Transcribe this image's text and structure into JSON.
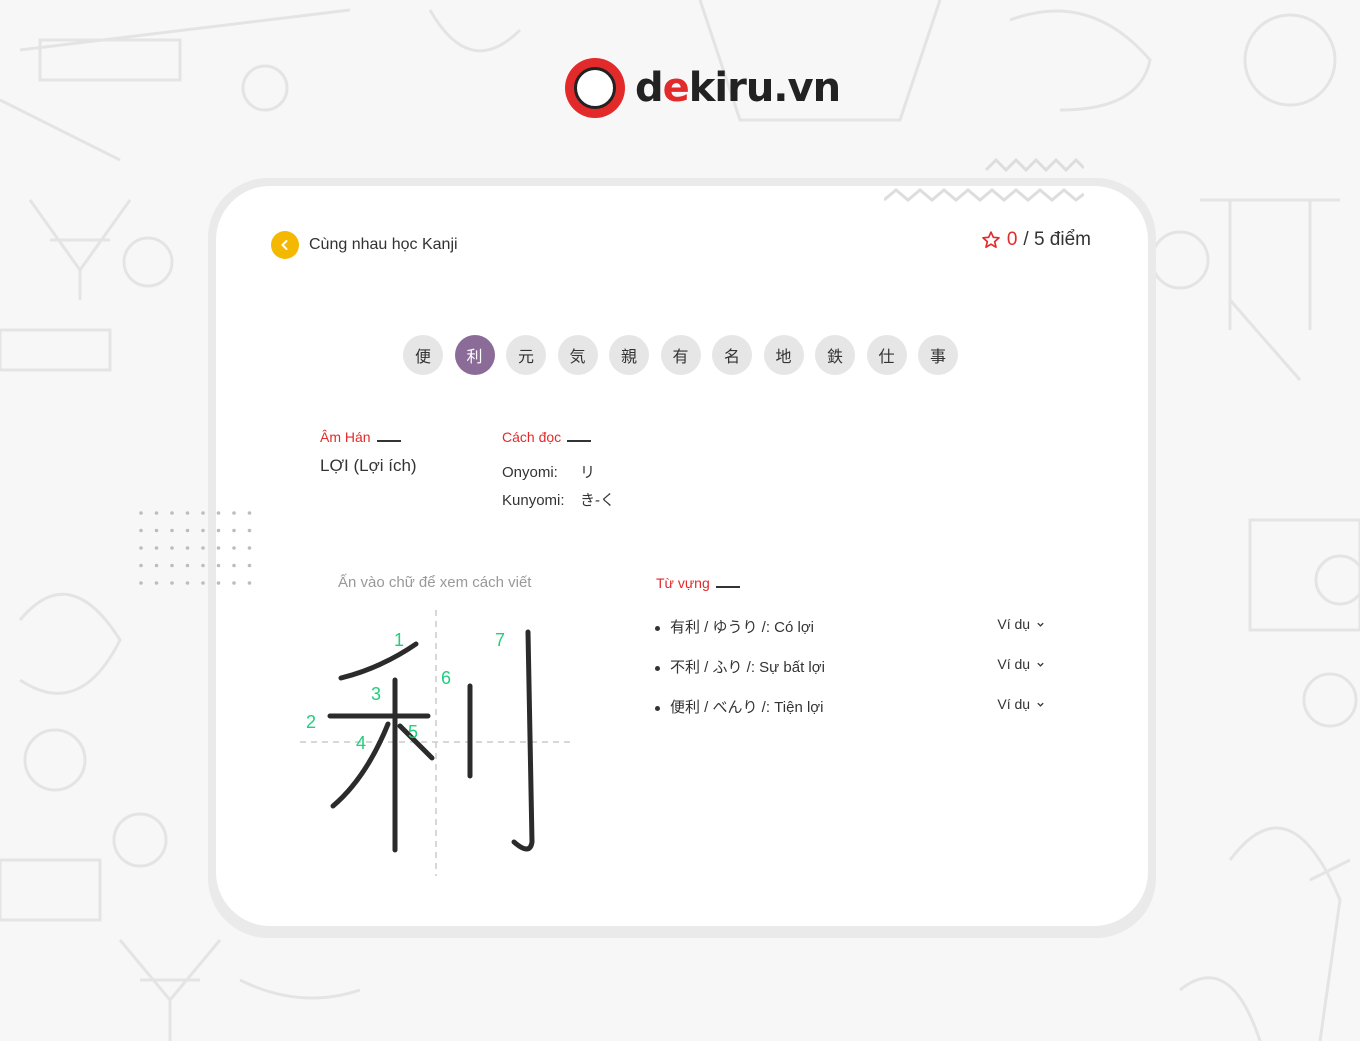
{
  "brand": {
    "name_prefix": "d",
    "name_accent": "e",
    "name_rest": "kiru.vn"
  },
  "header": {
    "back_label": "Cùng nhau học Kanji"
  },
  "score": {
    "current": "0",
    "total": "/ 5 điểm",
    "icon": "star-outline-icon"
  },
  "kanji_tabs": [
    "便",
    "利",
    "元",
    "気",
    "親",
    "有",
    "名",
    "地",
    "鉄",
    "仕",
    "事"
  ],
  "active_tab": 1,
  "amhan": {
    "title": "Âm Hán",
    "value": "LỢI (Lợi ích)"
  },
  "cach_doc": {
    "title": "Cách đọc",
    "onyomi_label": "Onyomi:",
    "onyomi_value": "リ",
    "kunyomi_label": "Kunyomi:",
    "kunyomi_value": "き-く"
  },
  "stroke": {
    "hint": "Ấn vào chữ để xem cách viết",
    "numbers": [
      "1",
      "2",
      "3",
      "4",
      "5",
      "6",
      "7"
    ]
  },
  "tu_vung": {
    "title": "Từ vựng",
    "items": [
      {
        "text": "有利 / ゆうり /: Có lợi",
        "example_label": "Ví dụ"
      },
      {
        "text": "不利 / ふり /: Sự bất lợi",
        "example_label": "Ví dụ"
      },
      {
        "text": "便利 / べんり /: Tiện lợi",
        "example_label": "Ví dụ"
      }
    ]
  },
  "colors": {
    "accent_red": "#e32a2a",
    "active_tab": "#8b6b97",
    "back_yellow": "#f5b800",
    "stroke_number_green": "#1fcf7c"
  }
}
